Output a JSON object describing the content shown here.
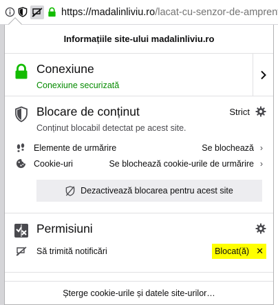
{
  "urlbar": {
    "url_host": "https://madalinliviu.ro",
    "url_path": "/lacat-cu-senzor-de-amprent"
  },
  "panel": {
    "title": "Informațiile site-ului madalinliviu.ro",
    "connection": {
      "title": "Conexiune",
      "status": "Conexiune securizată"
    },
    "content_blocking": {
      "title": "Blocare de conținut",
      "mode": "Strict",
      "subtitle": "Conținut blocabil detectat pe acest site.",
      "items": [
        {
          "label": "Elemente de urmărire",
          "value": "Se blochează"
        },
        {
          "label": "Cookie-uri",
          "value": "Se blochează cookie-urile de urmărire"
        }
      ],
      "disable_button": "Dezactivează blocarea pentru acest site"
    },
    "permissions": {
      "title": "Permisiuni",
      "items": [
        {
          "label": "Să trimită notificări",
          "value": "Blocat(ă)"
        }
      ]
    },
    "footer": "Șterge cookie-urile și datele site-urilor…"
  },
  "colors": {
    "green": "#12bc00",
    "secure_text": "#058b00",
    "highlight": "#ffff00"
  }
}
